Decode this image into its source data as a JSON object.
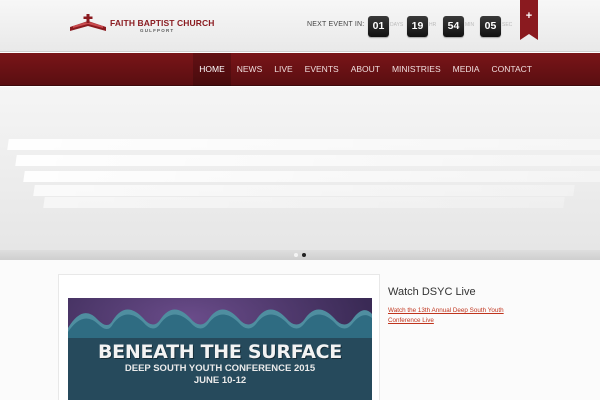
{
  "header": {
    "logo_text": "FAITH BAPTIST CHURCH",
    "logo_sub": "GULFPORT",
    "next_event_label": "NEXT EVENT IN:",
    "countdown": [
      {
        "value": "01",
        "unit": "DAYS"
      },
      {
        "value": "19",
        "unit": "HR"
      },
      {
        "value": "54",
        "unit": "MIN"
      },
      {
        "value": "05",
        "unit": "SEC"
      }
    ],
    "ribbon_icon": "plus-icon",
    "ribbon_symbol": "+"
  },
  "nav": {
    "items": [
      "HOME",
      "NEWS",
      "LIVE",
      "EVENTS",
      "ABOUT",
      "MINISTRIES",
      "MEDIA",
      "CONTACT"
    ],
    "active": "HOME"
  },
  "slider": {
    "dots": 2,
    "active_dot": 2
  },
  "banner": {
    "title": "BENEATH THE SURFACE",
    "subtitle": "DEEP SOUTH YOUTH CONFERENCE 2015",
    "date": "JUNE 10-12"
  },
  "sidebar": {
    "title": "Watch DSYC Live",
    "link": "Watch the 13th Annual Deep South Youth Conference Live"
  },
  "colors": {
    "brand": "#8a1a1f",
    "nav_bg": "#6a1214",
    "link": "#c0341d"
  }
}
